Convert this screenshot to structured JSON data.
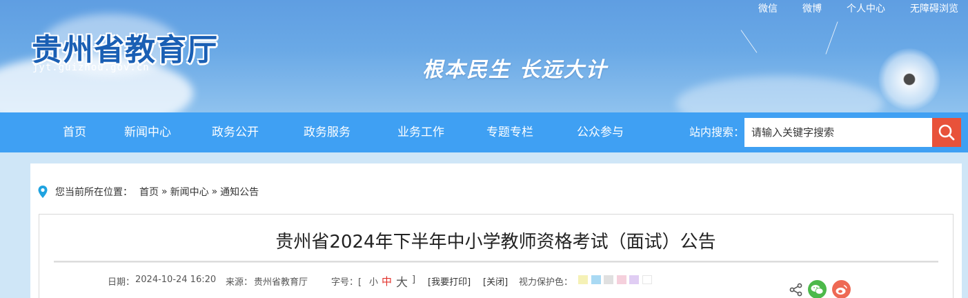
{
  "header": {
    "site_title": "贵州省教育厅",
    "domain": "jyt.guizhou.gov.cn",
    "slogan": "根本民生 长远大计",
    "top_links": [
      "微信",
      "微博",
      "个人中心",
      "无障碍浏览"
    ]
  },
  "nav": {
    "items": [
      "首页",
      "新闻中心",
      "政务公开",
      "政务服务",
      "业务工作",
      "专题专栏",
      "公众参与"
    ],
    "search_label": "站内搜索：",
    "search_placeholder": "请输入关键字搜索"
  },
  "breadcrumb": {
    "prefix": "您当前所在位置：",
    "items": [
      "首页",
      "新闻中心",
      "通知公告"
    ],
    "separator": "»"
  },
  "article": {
    "title": "贵州省2024年下半年中小学教师资格考试（面试）公告",
    "date_label": "日期：",
    "date": "2024-10-24 16:20",
    "source_label": "来源：",
    "source": "贵州省教育厅",
    "font_size_label": "字号：[",
    "font_small": "小",
    "font_medium": "中",
    "font_large": "大",
    "font_close": "]",
    "print": "[我要打印]",
    "close": "[关闭]",
    "eye_care_label": "视力保护色：",
    "eye_care_colors": [
      "#f5f1b6",
      "#a9d9f3",
      "#e0e0e0",
      "#f5d0dc",
      "#e0cdf3",
      "#ffffff"
    ]
  },
  "colors": {
    "nav_bg": "#3fa0f3",
    "search_button": "#e8523a",
    "accent_red": "#e2302a",
    "wechat_green": "#4cb94a",
    "weibo_red": "#ee6954"
  }
}
